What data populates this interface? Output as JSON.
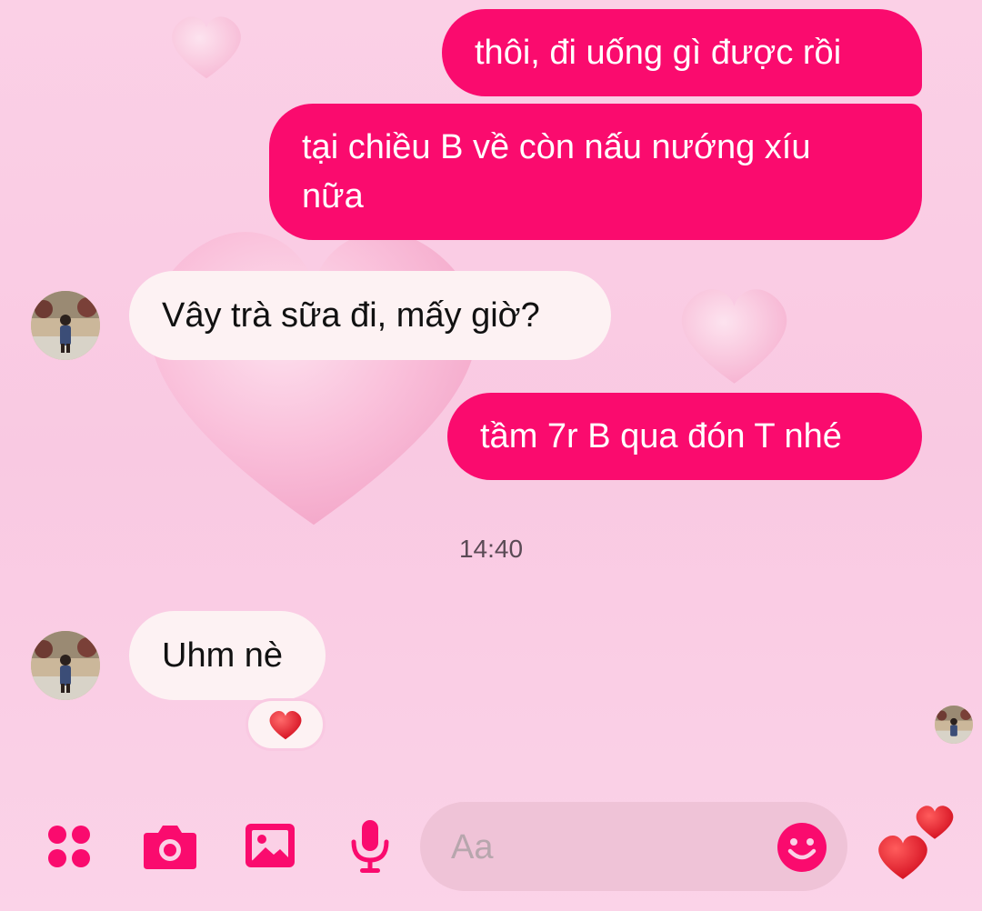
{
  "colors": {
    "accent": "#fa0b6e",
    "outgoing_bubble": "#fa0b6e",
    "incoming_bubble": "#fdf2f3",
    "background": "#fbd3e7"
  },
  "messages": [
    {
      "direction": "outgoing",
      "text": "thôi, đi uống gì được rồi"
    },
    {
      "direction": "outgoing",
      "lines": [
        "tại chiều B về còn nấu nướng xíu",
        "nữa"
      ]
    },
    {
      "direction": "incoming",
      "text": "Vây trà sữa đi, mấy giờ?"
    },
    {
      "direction": "outgoing",
      "text": "tầm 7r B qua đón T nhé"
    },
    {
      "direction": "incoming",
      "text": "Uhm nè",
      "reaction": "heart-emoji"
    }
  ],
  "timestamp": "14:40",
  "composer": {
    "placeholder": "Aa",
    "icons": [
      "apps-icon",
      "camera-icon",
      "gallery-icon",
      "microphone-icon",
      "emoji-icon",
      "hearts-icon"
    ]
  }
}
